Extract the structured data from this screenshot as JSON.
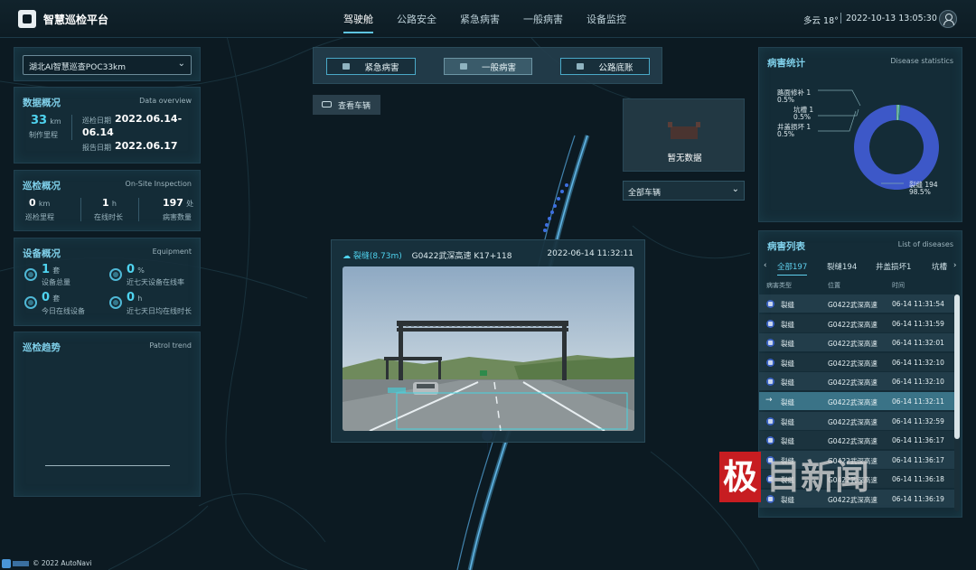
{
  "header": {
    "title": "智慧巡检平台",
    "nav": [
      "驾驶舱",
      "公路安全",
      "紧急病害",
      "一般病害",
      "设备监控"
    ],
    "weather": "多云 18°",
    "datetime": "2022-10-13 13:05:30"
  },
  "route_select": {
    "value": "湖北AI智慧巡查POC33km"
  },
  "data_overview": {
    "title": "数据概况",
    "subtitle": "Data overview",
    "mileage_value": "33",
    "mileage_unit": "km",
    "mileage_label": "制作里程",
    "inspect_date_label": "巡检日期",
    "inspect_date_line1": "2022.06.14-",
    "inspect_date_line2": "06.14",
    "report_date_label": "报告日期",
    "report_date": "2022.06.17"
  },
  "onsite": {
    "title": "巡检概况",
    "subtitle": "On-Site Inspection",
    "mileage_value": "0",
    "mileage_unit": "km",
    "mileage_label": "巡检里程",
    "duration_value": "1",
    "duration_unit": "h",
    "duration_label": "在线时长",
    "count_value": "197",
    "count_unit": "处",
    "count_label": "病害数量"
  },
  "equipment": {
    "title": "设备概况",
    "subtitle": "Equipment",
    "total_value": "1",
    "total_unit": "套",
    "total_label": "设备总量",
    "online_rate_value": "0",
    "online_rate_unit": "%",
    "online_rate_label": "近七天设备在线率",
    "today_online_value": "0",
    "today_online_unit": "套",
    "today_online_label": "今日在线设备",
    "avg_online_value": "0",
    "avg_online_unit": "h",
    "avg_online_label": "近七天日均在线时长"
  },
  "patrol_trend": {
    "title": "巡检趋势",
    "subtitle": "Patrol trend"
  },
  "top_tabs": [
    "紧急病害",
    "一般病害",
    "公路底账"
  ],
  "view_vehicle": "查看车辆",
  "nodata": {
    "text": "暂无数据"
  },
  "vehicle_select": {
    "value": "全部车辆"
  },
  "video": {
    "disease": "裂缝",
    "size": "(8.73m)",
    "location": "G0422武深高速 K17+118",
    "time": "2022-06-14 11:32:11"
  },
  "disease_stats": {
    "title": "病害统计",
    "subtitle": "Disease statistics",
    "label_1_name": "路面修补 1",
    "label_1_pct": "0.5%",
    "label_2_name": "坑槽 1",
    "label_2_pct": "0.5%",
    "label_3_name": "井盖损坏 1",
    "label_3_pct": "0.5%",
    "label_4_name": "裂缝 194",
    "label_4_pct": "98.5%"
  },
  "chart_data": {
    "type": "pie",
    "title": "病害统计",
    "categories": [
      "路面修补",
      "坑槽",
      "井盖损坏",
      "裂缝"
    ],
    "values": [
      1,
      1,
      1,
      194
    ],
    "percentages": [
      0.5,
      0.5,
      0.5,
      98.5
    ],
    "colors": [
      "#66a86a",
      "#84c8d8",
      "#2f8f7a",
      "#3d58c8"
    ]
  },
  "disease_list": {
    "title": "病害列表",
    "subtitle": "List of diseases",
    "tabs": [
      "全部197",
      "裂缝194",
      "井盖损坏1",
      "坑槽"
    ],
    "columns": [
      "病害类型",
      "位置",
      "时间"
    ],
    "rows": [
      {
        "type": "裂缝",
        "location": "G0422武深高速",
        "time": "06-14 11:31:54"
      },
      {
        "type": "裂缝",
        "location": "G0422武深高速",
        "time": "06-14 11:31:59"
      },
      {
        "type": "裂缝",
        "location": "G0422武深高速",
        "time": "06-14 11:32:01"
      },
      {
        "type": "裂缝",
        "location": "G0422武深高速",
        "time": "06-14 11:32:10"
      },
      {
        "type": "裂缝",
        "location": "G0422武深高速",
        "time": "06-14 11:32:10"
      },
      {
        "type": "裂缝",
        "location": "G0422武深高速",
        "time": "06-14 11:32:11"
      },
      {
        "type": "裂缝",
        "location": "G0422武深高速",
        "time": "06-14 11:32:59"
      },
      {
        "type": "裂缝",
        "location": "G0422武深高速",
        "time": "06-14 11:36:17"
      },
      {
        "type": "裂缝",
        "location": "G0422武深高速",
        "time": "06-14 11:36:17"
      },
      {
        "type": "裂缝",
        "location": "G0422武深高速",
        "time": "06-14 11:36:18"
      },
      {
        "type": "裂缝",
        "location": "G0422武深高速",
        "time": "06-14 11:36:19"
      }
    ]
  },
  "watermark": {
    "red": "极",
    "gray": "目新闻"
  },
  "footer": {
    "copyright": "© 2022 AutoNavi"
  }
}
